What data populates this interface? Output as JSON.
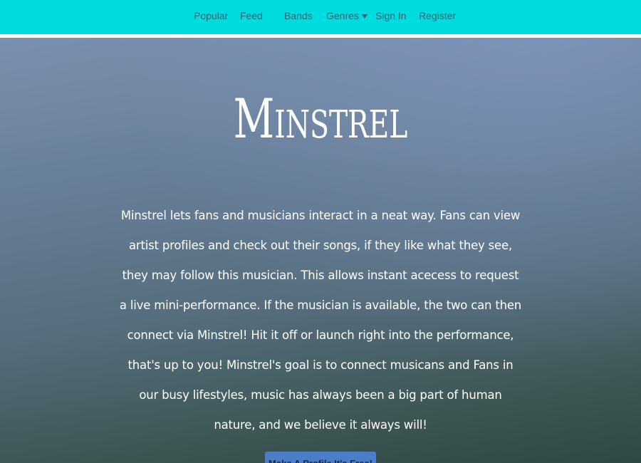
{
  "nav": {
    "items": [
      {
        "label": "Popular"
      },
      {
        "label": "Feed"
      },
      {
        "label": "Bands"
      },
      {
        "label": "Genres"
      },
      {
        "label": "Sign In"
      },
      {
        "label": "Register"
      }
    ],
    "genres_icon": "caret-down-icon"
  },
  "hero": {
    "title": "Minstrel",
    "description": "Minstrel lets fans and musicians interact in a neat way. Fans can view artist profiles and check out their songs, if they like what they see, they may follow this musician. This allows instant acecess to request a live mini-performance. If the musician is available, the two can then connect via Minstrel! Hit it off or launch right into the performance, that's up to you! Minstrel's goal is to connect musicans and Fans in our busy lifestyles, music has always been a big part of human nature, and we believe it always will!",
    "cta_label": "Make A Profile It's Free!"
  },
  "colors": {
    "navbar": "#00dbe0",
    "nav_text": "#2f6770",
    "cta": "#4a7ec9",
    "hero_top": "#7a8fae",
    "hero_bottom": "#2f4843"
  }
}
